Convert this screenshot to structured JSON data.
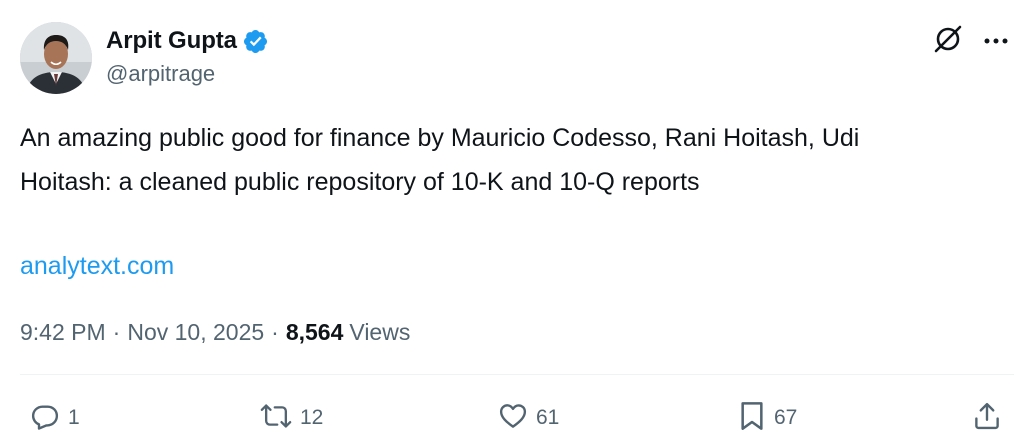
{
  "author": {
    "display_name": "Arpit Gupta",
    "handle": "@arpitrage",
    "verified": true,
    "verified_color": "#1d9bf0"
  },
  "tweet": {
    "text": "An amazing public good for finance by Mauricio Codesso, Rani Hoitash, Udi\nHoitash: a cleaned public repository of 10-K and 10-Q reports",
    "link": "analytext.com",
    "time": "9:42 PM",
    "date": "Nov 10, 2025",
    "views_count": "8,564",
    "views_label": "Views"
  },
  "actions": {
    "replies": "1",
    "retweets": "12",
    "likes": "61",
    "bookmarks": "67"
  },
  "icons": {
    "header": [
      "grok-icon",
      "more-icon"
    ],
    "actions": [
      "reply-icon",
      "retweet-icon",
      "like-icon",
      "bookmark-icon",
      "share-icon"
    ]
  },
  "colors": {
    "text": "#0f1419",
    "secondary": "#536471",
    "link": "#1d9bf0",
    "divider": "#eff3f4"
  }
}
